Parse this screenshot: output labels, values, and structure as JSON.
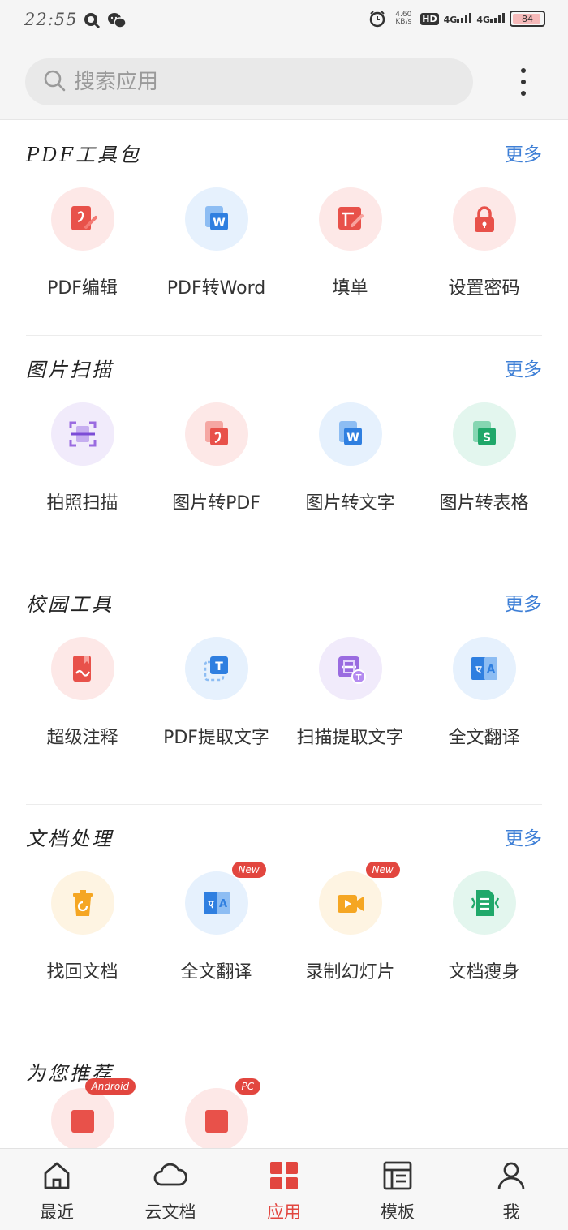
{
  "status_bar": {
    "time": "22:55",
    "net_speed_value": "4.60",
    "net_speed_unit": "KB/s",
    "hd": "HD",
    "sim1": "4G",
    "sim2": "4G",
    "battery": "84"
  },
  "search": {
    "placeholder": "搜索应用"
  },
  "sections": [
    {
      "title": "PDF工具包",
      "more": "更多",
      "items": [
        {
          "label": "PDF编辑",
          "icon": "pdf-edit-icon"
        },
        {
          "label": "PDF转Word",
          "icon": "pdf-to-word-icon"
        },
        {
          "label": "填单",
          "icon": "fill-form-icon"
        },
        {
          "label": "设置密码",
          "icon": "lock-icon"
        }
      ]
    },
    {
      "title": "图片扫描",
      "more": "更多",
      "items": [
        {
          "label": "拍照扫描",
          "icon": "scan-icon"
        },
        {
          "label": "图片转PDF",
          "icon": "image-to-pdf-icon"
        },
        {
          "label": "图片转文字",
          "icon": "image-to-text-icon"
        },
        {
          "label": "图片转表格",
          "icon": "image-to-sheet-icon"
        }
      ]
    },
    {
      "title": "校园工具",
      "more": "更多",
      "items": [
        {
          "label": "超级注释",
          "icon": "annotation-icon"
        },
        {
          "label": "PDF提取文字",
          "icon": "pdf-extract-text-icon"
        },
        {
          "label": "扫描提取文字",
          "icon": "scan-extract-text-icon"
        },
        {
          "label": "全文翻译",
          "icon": "translate-icon"
        }
      ]
    },
    {
      "title": "文档处理",
      "more": "更多",
      "items": [
        {
          "label": "找回文档",
          "icon": "recover-document-icon"
        },
        {
          "label": "全文翻译",
          "icon": "translate-icon",
          "badge": "New"
        },
        {
          "label": "录制幻灯片",
          "icon": "record-slides-icon",
          "badge": "New"
        },
        {
          "label": "文档瘦身",
          "icon": "slim-document-icon"
        }
      ]
    }
  ],
  "recommend": {
    "title": "为您推荐",
    "badges": [
      "Android",
      "PC"
    ]
  },
  "tabs": [
    {
      "label": "最近",
      "icon": "home-icon"
    },
    {
      "label": "云文档",
      "icon": "cloud-icon"
    },
    {
      "label": "应用",
      "icon": "apps-grid-icon",
      "active": true
    },
    {
      "label": "模板",
      "icon": "template-icon"
    },
    {
      "label": "我",
      "icon": "user-icon"
    }
  ],
  "colors": {
    "accent_red": "#e2463f",
    "link_blue": "#3e7fd6"
  }
}
